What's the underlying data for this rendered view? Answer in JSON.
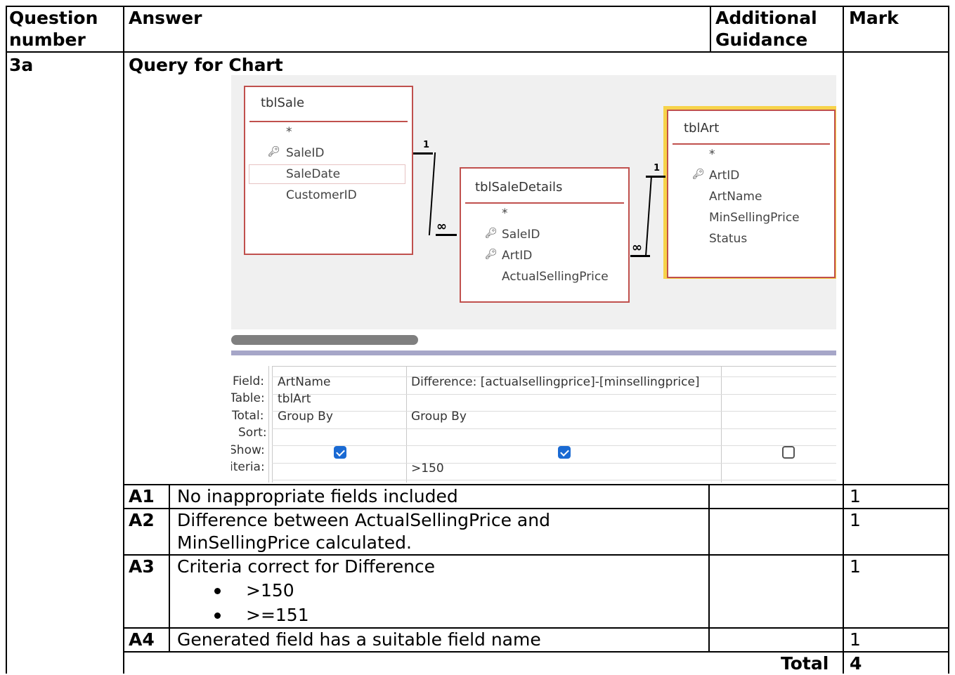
{
  "header": {
    "question_number": "Question number",
    "answer": "Answer",
    "additional_guidance": "Additional Guidance",
    "mark": "Mark"
  },
  "question": {
    "number": "3a",
    "title": "Query for Chart"
  },
  "access": {
    "tables": [
      {
        "name": "tblSale",
        "fields": [
          "*",
          "SaleID",
          "SaleDate",
          "CustomerID"
        ]
      },
      {
        "name": "tblSaleDetails",
        "fields": [
          "*",
          "SaleID",
          "ArtID",
          "ActualSellingPrice"
        ]
      },
      {
        "name": "tblArt",
        "fields": [
          "*",
          "ArtID",
          "ArtName",
          "MinSellingPrice",
          "Status"
        ]
      }
    ],
    "relationships": [
      {
        "one_label": "1",
        "many_label": "∞"
      },
      {
        "one_label": "1",
        "many_label": "∞"
      }
    ],
    "grid": {
      "labels": {
        "field": "Field:",
        "table": "Table:",
        "total": "Total:",
        "sort": "Sort:",
        "show": "Show:",
        "criteria": "iteria:"
      },
      "col1": {
        "field": "ArtName",
        "table": "tblArt",
        "total": "Group By",
        "show": true,
        "criteria": ""
      },
      "col2": {
        "field": "Difference: [actualsellingprice]-[minsellingprice]",
        "table": "",
        "total": "Group By",
        "show": true,
        "criteria": ">150"
      },
      "col3": {
        "field": "",
        "table": "",
        "total": "",
        "show": false,
        "criteria": ""
      }
    }
  },
  "marks": [
    {
      "id": "A1",
      "text": "No inappropriate fields included",
      "mark": "1"
    },
    {
      "id": "A2",
      "text_line1": "Difference between ActualSellingPrice and",
      "text_line2": "MinSellingPrice calculated.",
      "mark": "1"
    },
    {
      "id": "A3",
      "text": "Criteria correct for Difference",
      "bullets": [
        ">150",
        ">=151"
      ],
      "mark": "1"
    },
    {
      "id": "A4",
      "text": "Generated field has a suitable field name",
      "mark": "1"
    }
  ],
  "total": {
    "label": "Total",
    "value": "4"
  }
}
